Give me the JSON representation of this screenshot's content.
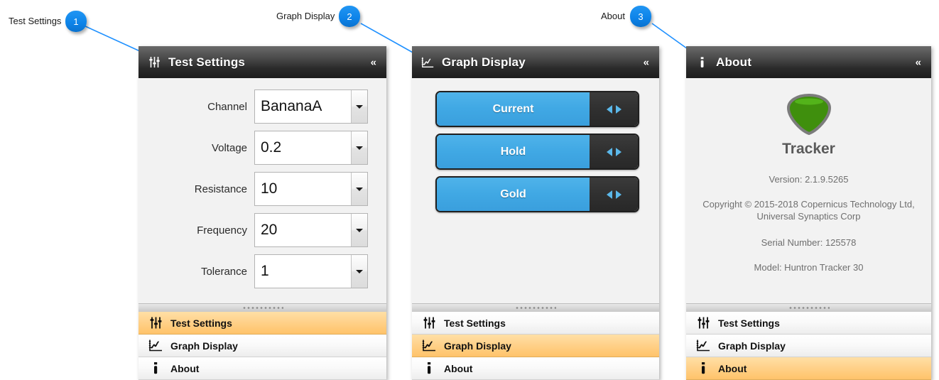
{
  "callouts": [
    {
      "number": "1",
      "label": "Test Settings"
    },
    {
      "number": "2",
      "label": "Graph Display"
    },
    {
      "number": "3",
      "label": "About"
    }
  ],
  "colors": {
    "accent_blue": "#0d83e8",
    "button_blue": "#40a8e4",
    "active_tab_amber": "#ffd189",
    "header_dark": "#2a2a2a",
    "logo_green": "#3f8f0d"
  },
  "panels": {
    "test_settings": {
      "header": {
        "title": "Test Settings",
        "icon": "sliders-icon",
        "collapse": "«"
      },
      "fields": [
        {
          "label": "Channel",
          "value": "BananaA"
        },
        {
          "label": "Voltage",
          "value": "0.2"
        },
        {
          "label": "Resistance",
          "value": "10"
        },
        {
          "label": "Frequency",
          "value": "20"
        },
        {
          "label": "Tolerance",
          "value": "1"
        }
      ]
    },
    "graph_display": {
      "header": {
        "title": "Graph Display",
        "icon": "graph-icon",
        "collapse": "«"
      },
      "buttons": [
        {
          "label": "Current"
        },
        {
          "label": "Hold"
        },
        {
          "label": "Gold"
        }
      ]
    },
    "about": {
      "header": {
        "title": "About",
        "icon": "info-icon",
        "collapse": "«"
      },
      "app_name": "Tracker",
      "version": "Version: 2.1.9.5265",
      "copyright": "Copyright © 2015-2018 Copernicus Technology Ltd, Universal Synaptics Corp",
      "serial": "Serial Number: 125578",
      "model": "Model: Huntron Tracker 30"
    }
  },
  "tabs": [
    {
      "label": "Test Settings",
      "icon": "sliders-icon"
    },
    {
      "label": "Graph Display",
      "icon": "graph-icon"
    },
    {
      "label": "About",
      "icon": "info-icon"
    }
  ],
  "active_tab": {
    "panel1": 0,
    "panel2": 1,
    "panel3": 2
  }
}
